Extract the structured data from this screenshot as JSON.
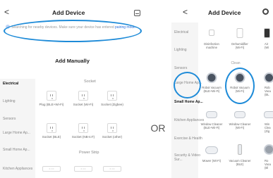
{
  "left_screen": {
    "back_glyph": "<",
    "title": "Add Device",
    "notice_text": "Searching for nearby devices. Make sure your device has entered ",
    "notice_link": "pairing mode",
    "notice_end": ".",
    "add_manually": "Add Manually",
    "categories": [
      "Electrical",
      "Lighting",
      "Sensors",
      "Large Home Ap...",
      "Small Home Ap...",
      "Kitchen Appliances"
    ],
    "sections": {
      "socket": "Socket",
      "power_strip": "Power Strip"
    },
    "devices": [
      {
        "label": "Plug (BLE+Wi-Fi)"
      },
      {
        "label": "Socket (Wi-Fi)"
      },
      {
        "label": "Socket (Zigbee)"
      },
      {
        "label": "Socket (BLE)"
      },
      {
        "label": "Socket (NB-IoT)"
      },
      {
        "label": "Socket (other)"
      }
    ],
    "strip_glyph": "= ○○"
  },
  "separator": "OR",
  "right_screen": {
    "back_glyph": "<",
    "title": "Add Device",
    "categories": [
      "Electrical",
      "Lighting",
      "Sensors",
      "Large Home Ap...",
      "Small Home Ap...",
      "Kitchen Appliances",
      "Exercise & Health",
      "Security & Video Sur..."
    ],
    "active_category": "Small Home Ap...",
    "top_tiles": [
      {
        "label": "Disinfection machine"
      },
      {
        "label": "Dehumidifier (Wi-Fi)"
      },
      {
        "label": "Air (Wi"
      }
    ],
    "section_label": "Clean",
    "tiles": [
      {
        "label": "Robot Vacuum (BLE+Wi-Fi)"
      },
      {
        "label": "Robot Vacuum (Wi-Fi)"
      },
      {
        "label": "Rob Vacu (BL"
      },
      {
        "label": "Window Cleaner (BLE+Wi-Fi)"
      },
      {
        "label": "Window Cleaner (Wi-Fi)"
      },
      {
        "label": "Win Clea (Zig"
      },
      {
        "label": "Mower (Wi-Fi)"
      },
      {
        "label": "Vacuum Cleaner (BLE)"
      },
      {
        "label": "Ro Vacu (Bl"
      }
    ]
  },
  "colors": {
    "highlight": "#1e8bd8",
    "link": "#2a6fdb",
    "sidebar_bg": "#f5f5f5"
  }
}
